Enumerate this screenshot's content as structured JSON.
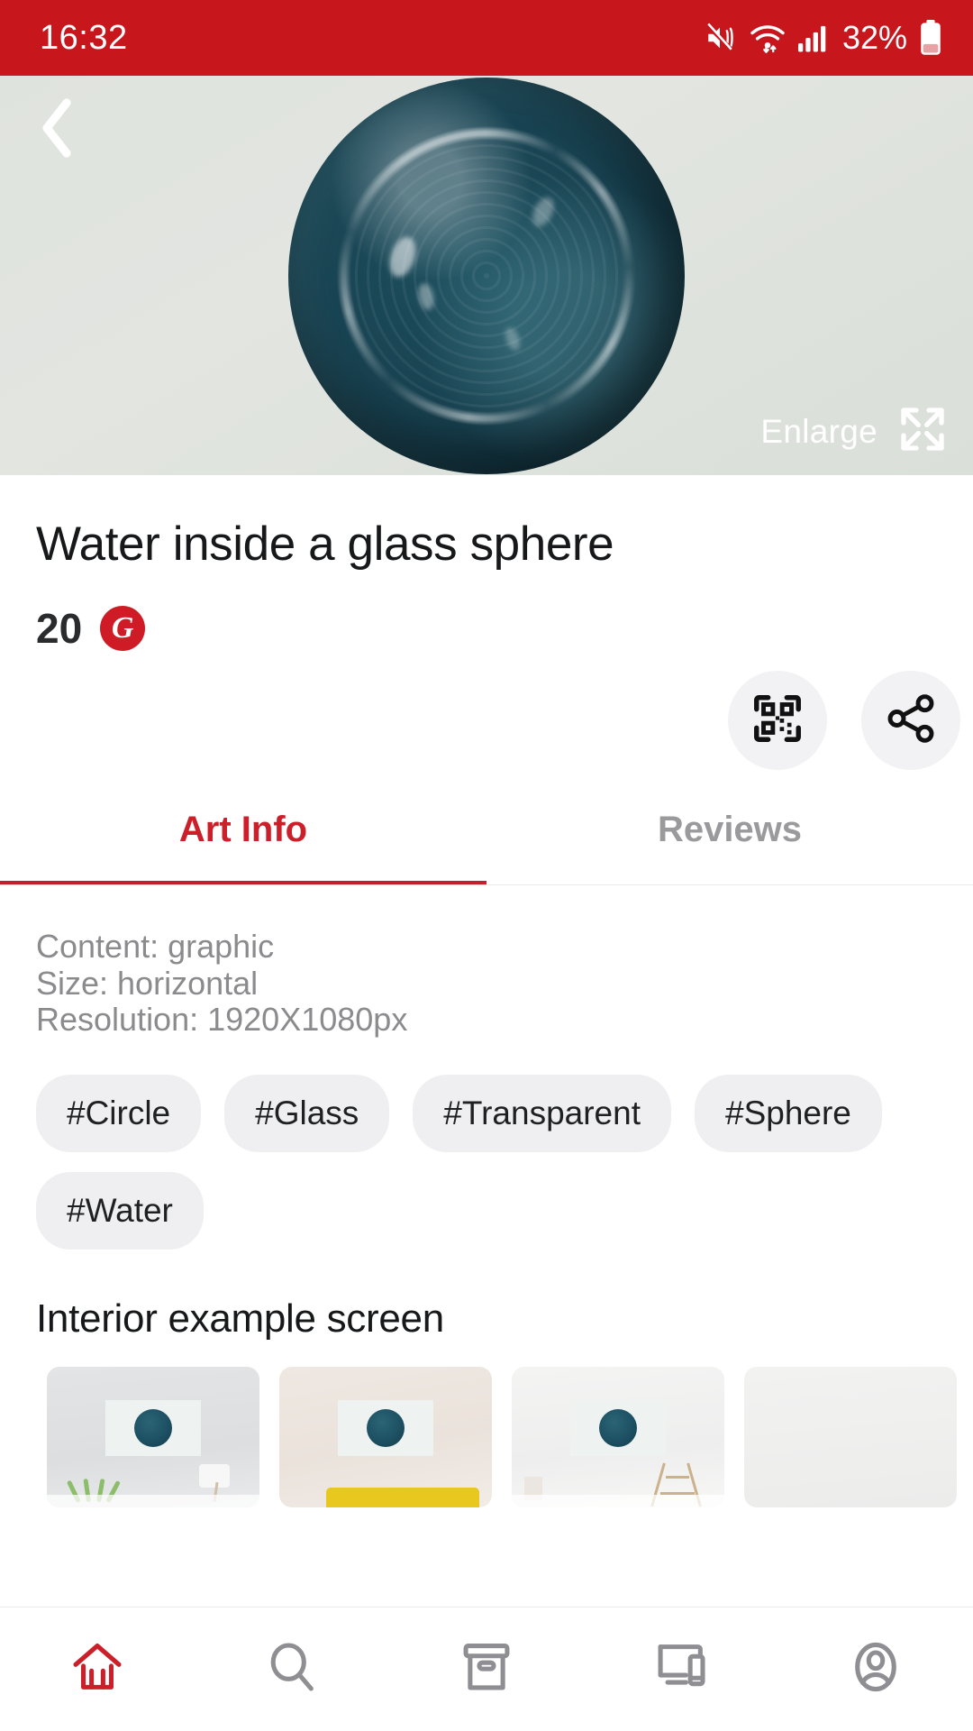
{
  "statusbar": {
    "time": "16:32",
    "battery_percent": "32%",
    "icons": [
      "mute-icon",
      "wifi-icon",
      "signal-icon",
      "battery-icon"
    ],
    "background_color": "#c8161d"
  },
  "hero": {
    "back_icon": "back-chevron-icon",
    "enlarge_label": "Enlarge",
    "enlarge_icon": "expand-icon",
    "artwork_alt": "Water inside a glass sphere"
  },
  "product": {
    "title": "Water inside a glass sphere",
    "price": "20",
    "currency_symbol": "G",
    "currency_color": "#cf1b25"
  },
  "actions": [
    {
      "name": "qr-code-button",
      "icon": "qr-code-icon"
    },
    {
      "name": "share-button",
      "icon": "share-icon"
    }
  ],
  "tabs": {
    "active_index": 0,
    "accent_color": "#cc1f2a",
    "items": [
      {
        "label": "Art Info"
      },
      {
        "label": "Reviews"
      }
    ]
  },
  "art_info": {
    "meta": [
      "Content: graphic",
      "Size: horizontal",
      "Resolution: 1920X1080px"
    ],
    "tags": [
      "#Circle",
      "#Glass",
      "#Transparent",
      "#Sphere",
      "#Water"
    ],
    "interior_section_title": "Interior example screen",
    "interior_examples": [
      {
        "name": "interior-gray-wall-plant-lamp"
      },
      {
        "name": "interior-beige-wall-yellow-sofa"
      },
      {
        "name": "interior-white-wall-ladder"
      },
      {
        "name": "interior-partial"
      }
    ]
  },
  "bottom_nav": {
    "active_index": 0,
    "active_color": "#cc1f2a",
    "inactive_color": "#8e8e93",
    "items": [
      {
        "name": "home",
        "icon": "home-icon"
      },
      {
        "name": "search",
        "icon": "search-icon"
      },
      {
        "name": "archive",
        "icon": "archive-box-icon"
      },
      {
        "name": "devices",
        "icon": "devices-icon"
      },
      {
        "name": "account",
        "icon": "account-icon"
      }
    ]
  }
}
